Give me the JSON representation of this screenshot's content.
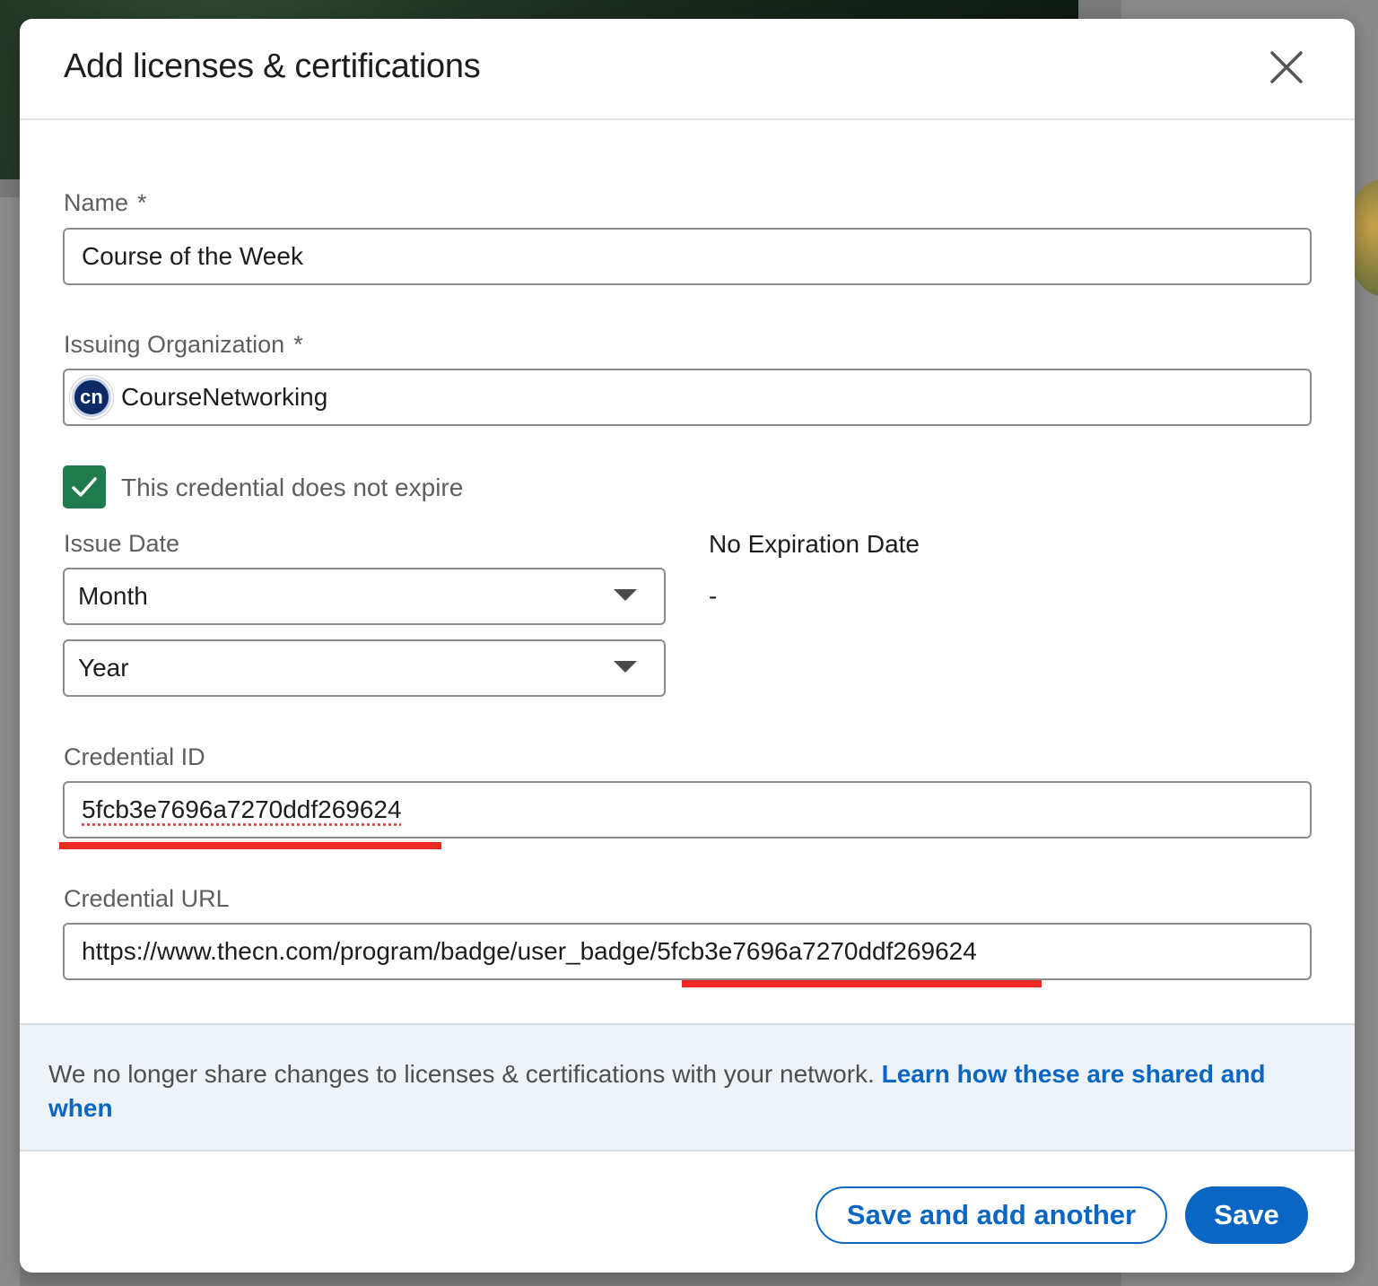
{
  "modal": {
    "title": "Add licenses & certifications",
    "close_icon": "close-icon"
  },
  "form": {
    "name": {
      "label": "Name",
      "required_mark": "*",
      "value": "Course of the Week"
    },
    "org": {
      "label": "Issuing Organization",
      "required_mark": "*",
      "value": "CourseNetworking",
      "logo_text": "cn"
    },
    "no_expire": {
      "label": "This credential does not expire",
      "checked": true
    },
    "issue_date": {
      "label": "Issue Date",
      "month": "Month",
      "year": "Year"
    },
    "expiration": {
      "label": "No Expiration Date",
      "value": "-"
    },
    "credential_id": {
      "label": "Credential ID",
      "value": "5fcb3e7696a7270ddf269624"
    },
    "credential_url": {
      "label": "Credential URL",
      "value": "https://www.thecn.com/program/badge/user_badge/5fcb3e7696a7270ddf269624"
    }
  },
  "notice": {
    "text": "We no longer share changes to licenses & certifications with your network. ",
    "link": "Learn how these are shared and when"
  },
  "footer": {
    "save_another": "Save and add another",
    "save": "Save"
  },
  "colors": {
    "primary": "#0a66c2",
    "checkbox": "#1f7a4d",
    "highlight": "#ec2a20"
  }
}
